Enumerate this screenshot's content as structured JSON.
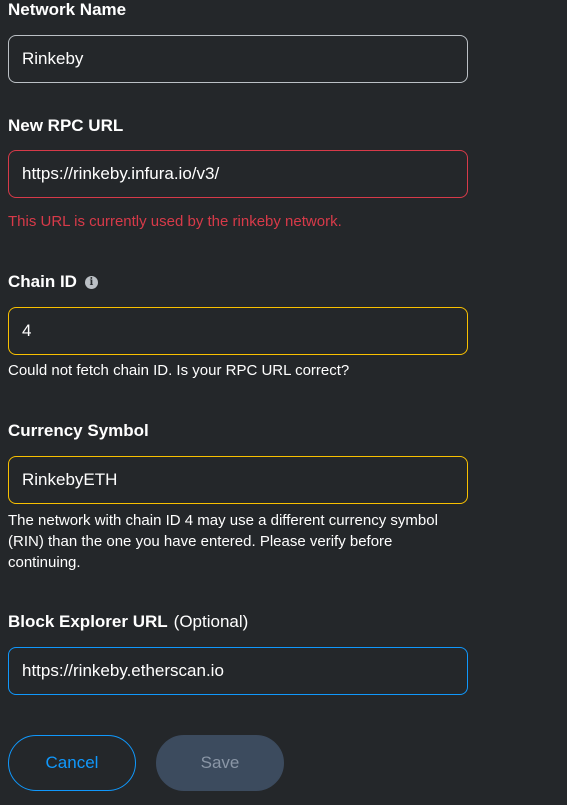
{
  "form": {
    "network_name": {
      "label": "Network Name",
      "value": "Rinkeby"
    },
    "rpc_url": {
      "label": "New RPC URL",
      "value": "https://rinkeby.infura.io/v3/",
      "error": "This URL is currently used by the rinkeby network."
    },
    "chain_id": {
      "label": "Chain ID",
      "info_icon": "info-icon",
      "value": "4",
      "warning": "Could not fetch chain ID. Is your RPC URL correct?"
    },
    "currency_symbol": {
      "label": "Currency Symbol",
      "value": "RinkebyETH",
      "warning": "The network with chain ID 4 may use a different currency symbol (RIN) than the one you have entered. Please verify before continuing."
    },
    "block_explorer": {
      "label": "Block Explorer URL",
      "optional_label": "(Optional)",
      "value": "https://rinkeby.etherscan.io"
    }
  },
  "buttons": {
    "cancel_label": "Cancel",
    "save_label": "Save"
  },
  "colors": {
    "background": "#24272a",
    "error": "#d73a49",
    "warning": "#f8c000",
    "focus": "#1098fc",
    "disabled_button": "#3c4b5e"
  }
}
